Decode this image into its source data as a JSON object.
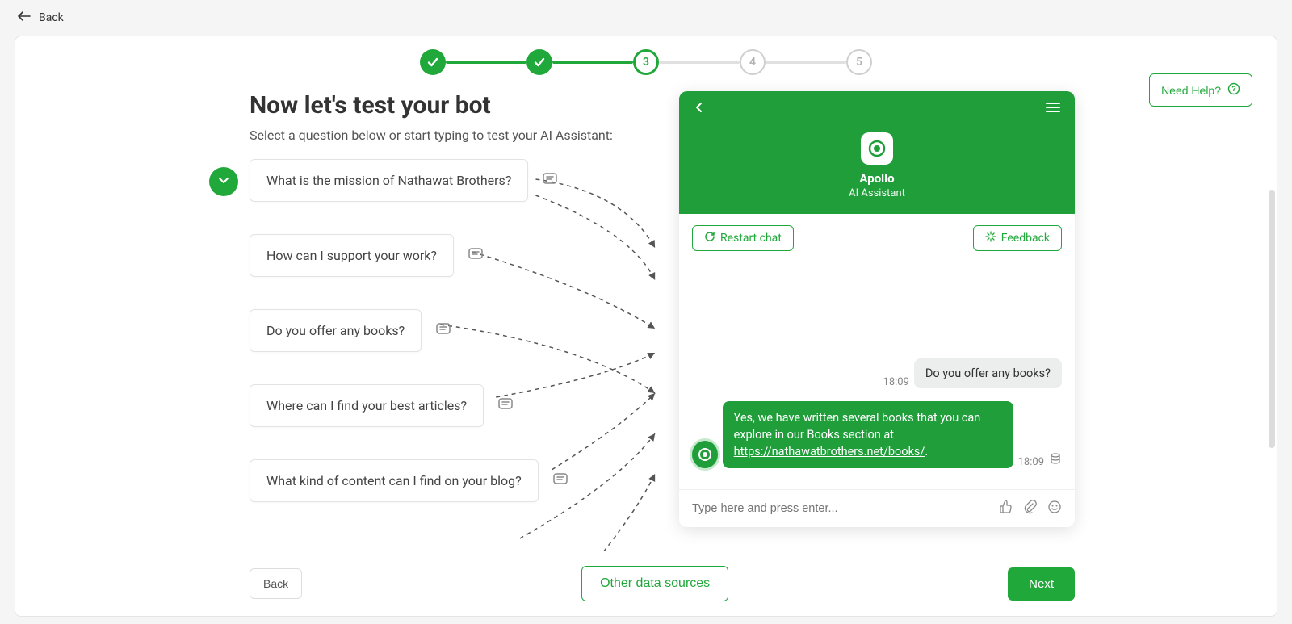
{
  "colors": {
    "primary": "#21a83b"
  },
  "nav": {
    "back_label": "Back"
  },
  "stepper": {
    "steps": [
      "1",
      "2",
      "3",
      "4",
      "5"
    ],
    "current_index": 2
  },
  "help": {
    "label": "Need Help?"
  },
  "page": {
    "title": "Now let's test your bot",
    "subtitle": "Select a question below or start typing to test your AI Assistant:"
  },
  "questions": [
    "What is the mission of Nathawat Brothers?",
    "How can I support your work?",
    "Do you offer any books?",
    "Where can I find your best articles?",
    "What kind of content can I find on your blog?"
  ],
  "chat": {
    "name": "Apollo",
    "role": "AI Assistant",
    "restart_label": "Restart chat",
    "feedback_label": "Feedback",
    "input_placeholder": "Type here and press enter...",
    "messages": {
      "user": {
        "text": "Do you offer any books?",
        "time": "18:09"
      },
      "bot": {
        "text_before": "Yes, we have written several books that you can explore in our Books section at ",
        "link_text": "https://nathawatbrothers.net/books/",
        "text_after": ".",
        "time": "18:09"
      }
    }
  },
  "footer": {
    "back_label": "Back",
    "other_label": "Other data sources",
    "next_label": "Next"
  }
}
